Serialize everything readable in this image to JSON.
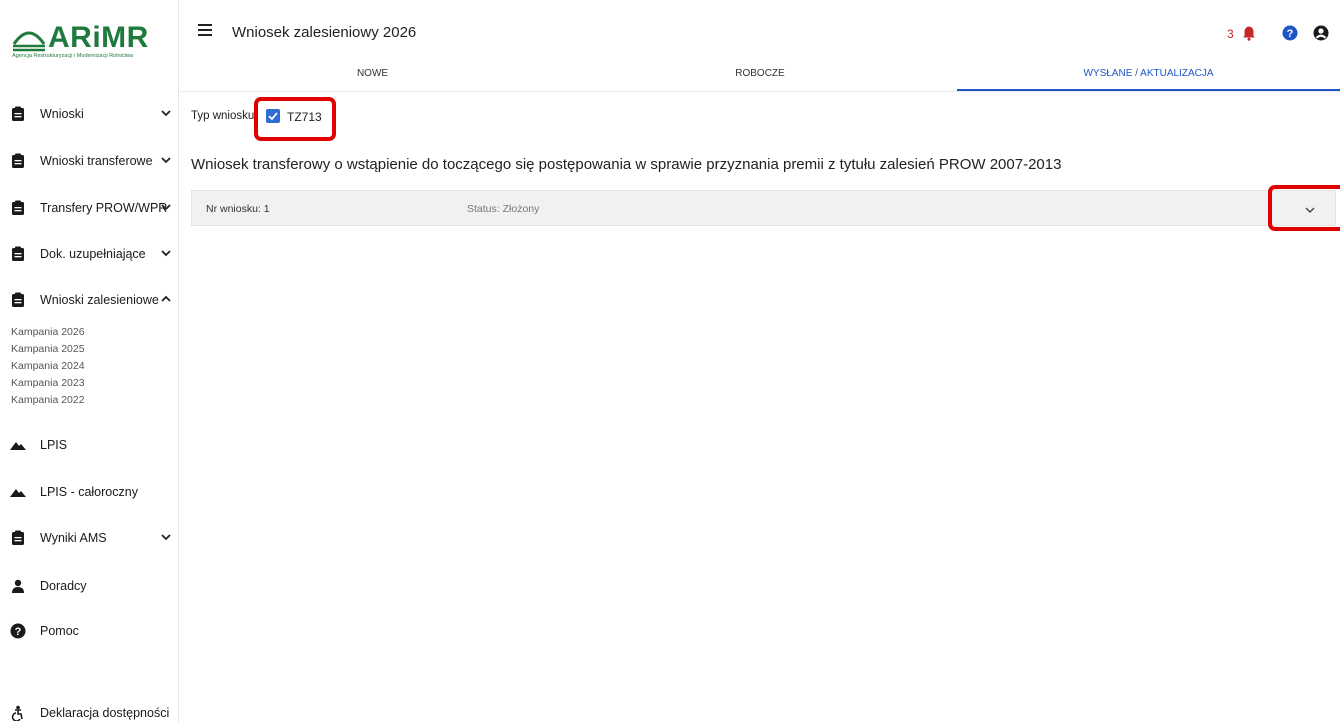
{
  "logo": {
    "text": "ARiMR",
    "subtitle": "Agencja Restrukturyzacji i Modernizacji Rolnictwa"
  },
  "sidebar": {
    "items": [
      {
        "label": "Wnioski",
        "icon": "clipboard-icon",
        "chevron": "down"
      },
      {
        "label": "Wnioski transferowe",
        "icon": "clipboard-icon",
        "chevron": "down"
      },
      {
        "label": "Transfery PROW/WPR",
        "icon": "clipboard-icon",
        "chevron": "down"
      },
      {
        "label": "Dok. uzupełniające",
        "icon": "clipboard-icon",
        "chevron": "down"
      },
      {
        "label": "Wnioski zalesieniowe",
        "icon": "clipboard-icon",
        "chevron": "up"
      },
      {
        "label": "LPIS",
        "icon": "mountain-icon"
      },
      {
        "label": "LPIS - całoroczny",
        "icon": "mountain-icon"
      },
      {
        "label": "Wyniki AMS",
        "icon": "clipboard-icon",
        "chevron": "down"
      },
      {
        "label": "Doradcy",
        "icon": "person-icon"
      },
      {
        "label": "Pomoc",
        "icon": "help-icon"
      },
      {
        "label": "Deklaracja dostępności",
        "icon": "accessibility-icon"
      }
    ],
    "subitems": [
      "Kampania 2026",
      "Kampania 2025",
      "Kampania 2024",
      "Kampania 2023",
      "Kampania 2022"
    ]
  },
  "header": {
    "title": "Wniosek zalesieniowy 2026",
    "notification_count": "3"
  },
  "tabs": [
    "NOWE",
    "ROBOCZE",
    "WYSŁANE / AKTUALIZACJA"
  ],
  "active_tab": "WYSŁANE / AKTUALIZACJA",
  "filter": {
    "label": "Typ wniosku",
    "option": "TZ713",
    "checked": true
  },
  "section": {
    "title": "Wniosek transferowy o wstąpienie do toczącego się postępowania w sprawie przyznania premii z tytułu zalesień PROW 2007-2013"
  },
  "application": {
    "nr": "Nr wniosku: 1",
    "status": "Status: Złożony"
  },
  "colors": {
    "brand": "#1f7a3d",
    "accent": "#1e56c7",
    "highlight": "#e00000",
    "notification": "#c62828"
  }
}
